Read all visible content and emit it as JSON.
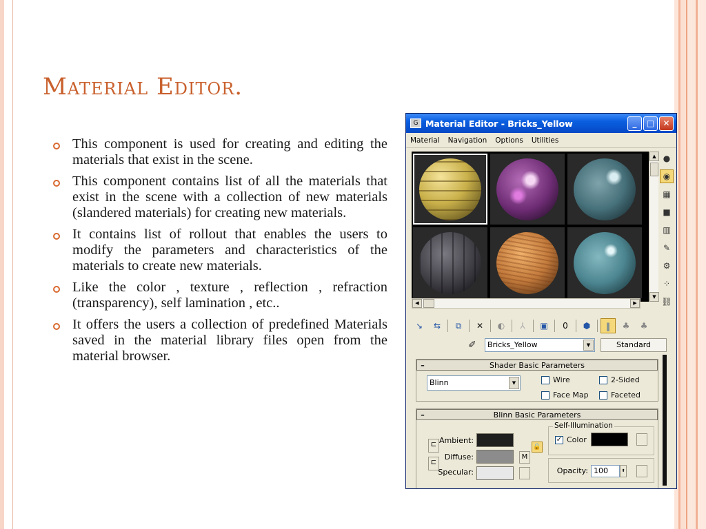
{
  "slide": {
    "title": "Material Editor.",
    "bullets": [
      "This component is used for creating and editing the materials that exist in the scene.",
      "This component contains list of all the materials that exist in the scene with a collection of new materials (slandered materials) for creating new materials.",
      "It contains list of rollout that enables the users to modify the parameters and characteristics of the materials to create new materials.",
      "Like the color , texture , reflection , refraction (transparency), self lamination , etc..",
      "It offers the users a collection of predefined Materials saved in the material library files open from the material browser."
    ],
    "accent_color": "#c9602d",
    "bullet_color": "#d9692f"
  },
  "window": {
    "title": "Material Editor - Bricks_Yellow",
    "app_icon": "3dsmax-icon",
    "controls": [
      "minimize-icon",
      "maximize-icon",
      "close-icon"
    ],
    "menu": [
      "Material",
      "Navigation",
      "Options",
      "Utilities"
    ],
    "sample_slots": [
      {
        "icon": "bricks-yellow-sphere",
        "color": "#c9b04a",
        "active": true
      },
      {
        "icon": "purple-marble-sphere",
        "color": "#8a3f8f",
        "active": false
      },
      {
        "icon": "teal-metal-sphere",
        "color": "#46707a",
        "active": false
      },
      {
        "icon": "dark-stone-sphere",
        "color": "#45434a",
        "active": false
      },
      {
        "icon": "wood-sphere",
        "color": "#c27a3c",
        "active": false
      },
      {
        "icon": "teal-glossy-sphere",
        "color": "#4c8590",
        "active": false
      }
    ],
    "side_tools": [
      "sample-type-icon",
      "backlight-icon",
      "background-icon",
      "tiling-icon",
      "video-check-icon",
      "make-preview-icon",
      "options-icon",
      "select-by-material-icon",
      "material-map-navigator-icon"
    ],
    "toolbar": [
      "get-material-icon",
      "put-to-scene-icon",
      "assign-material-icon",
      "reset-icon",
      "make-copy-icon",
      "make-unique-icon",
      "put-to-library-icon",
      "material-effects-channel-icon",
      "show-map-icon",
      "show-end-result-icon",
      "go-to-parent-icon",
      "go-forward-icon"
    ],
    "material_name": "Bricks_Yellow",
    "material_type": "Standard",
    "shader_rollout": {
      "title": "Shader Basic Parameters",
      "shader": "Blinn",
      "wire_label": "Wire",
      "two_sided_label": "2-Sided",
      "face_map_label": "Face Map",
      "faceted_label": "Faceted"
    },
    "blinn_rollout": {
      "title": "Blinn Basic Parameters",
      "ambient_label": "Ambient:",
      "diffuse_label": "Diffuse:",
      "specular_label": "Specular:",
      "map_button": "M",
      "self_illum_label": "Self-Illumination",
      "color_label": "Color",
      "opacity_label": "Opacity:",
      "opacity_value": "100",
      "ambient_color": "#1e1e1e",
      "diffuse_color": "#8c8c8c",
      "specular_color": "#e8e8e8",
      "self_illum_color": "#000000"
    }
  }
}
